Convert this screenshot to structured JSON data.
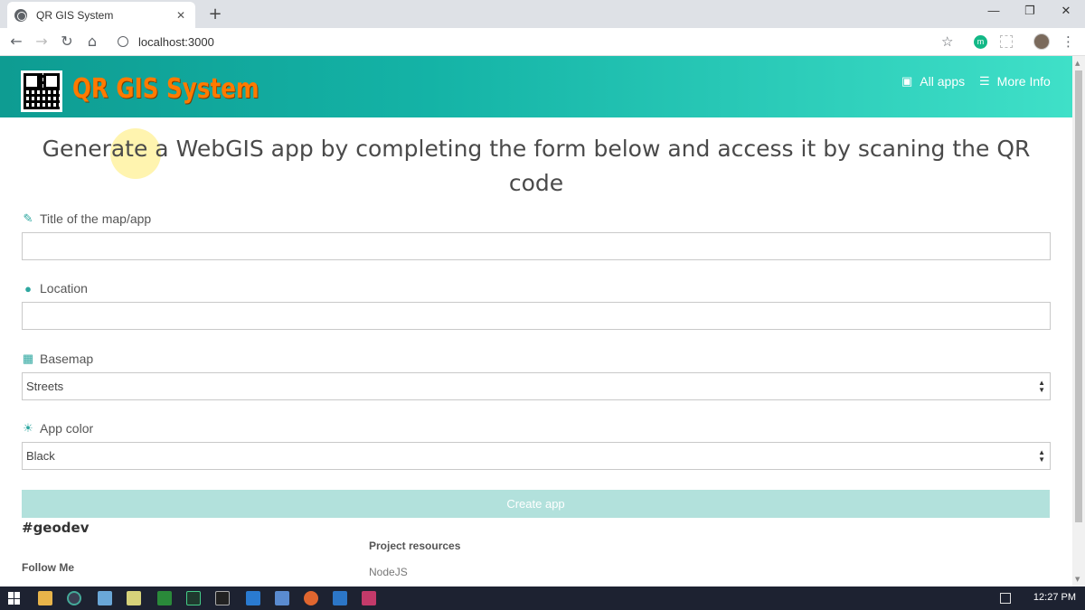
{
  "browser": {
    "tab_title": "QR GIS System",
    "tab_close": "✕",
    "new_tab": "+",
    "window_controls": [
      "—",
      "❐",
      "✕"
    ],
    "url": "localhost:3000",
    "extension_label": "m"
  },
  "header": {
    "brand": "QR GIS System",
    "nav": [
      {
        "label": "All apps",
        "icon": "apps-icon"
      },
      {
        "label": "More Info",
        "icon": "menu-icon"
      }
    ]
  },
  "main": {
    "heading": "Generate a WebGIS app by completing the form below and access it by scaning the QR code",
    "fields": {
      "title": {
        "label": "Title of the map/app",
        "value": ""
      },
      "location": {
        "label": "Location",
        "value": ""
      },
      "basemap": {
        "label": "Basemap",
        "value": "Streets"
      },
      "color": {
        "label": "App color",
        "value": "Black"
      }
    },
    "create_button": "Create app"
  },
  "footer": {
    "hashtag": "#geodev",
    "follow": "Follow Me",
    "resources_title": "Project resources",
    "resources": [
      "NodeJS"
    ]
  },
  "taskbar": {
    "time": "12:27 PM"
  },
  "colors": {
    "header_start": "#0e9c92",
    "header_end": "#3fe0c8",
    "brand": "#ff7a00",
    "button": "#b2e1dc"
  }
}
